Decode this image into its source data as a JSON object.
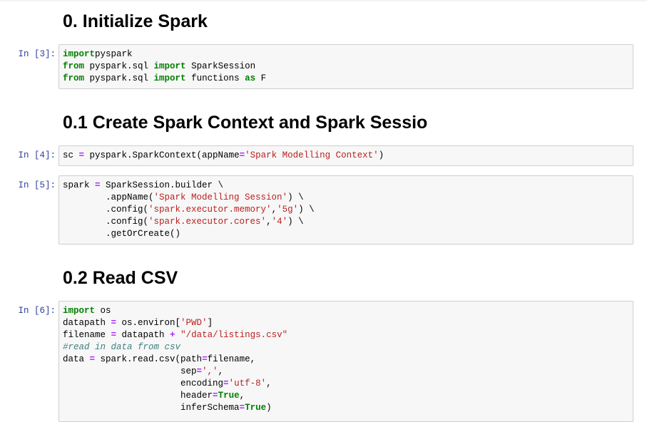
{
  "headings": {
    "h0": "0. Initialize Spark",
    "h1": "0.1 Create Spark Context and Spark Sessio",
    "h2": "0.2 Read CSV"
  },
  "prompts": {
    "p3": "In [3]:",
    "p4": "In [4]:",
    "p5": "In [5]:",
    "p6": "In [6]:"
  },
  "cells": {
    "c3": [
      [
        [
          "k",
          "import"
        ],
        [
          "",
          "pyspark"
        ]
      ],
      [
        [
          "k",
          "from"
        ],
        [
          "",
          " pyspark.sql "
        ],
        [
          "k",
          "import"
        ],
        [
          "",
          " SparkSession"
        ]
      ],
      [
        [
          "k",
          "from"
        ],
        [
          "",
          " pyspark.sql "
        ],
        [
          "k",
          "import"
        ],
        [
          "",
          " functions "
        ],
        [
          "k",
          "as"
        ],
        [
          "",
          " F"
        ]
      ]
    ],
    "c4": [
      [
        [
          "",
          "sc "
        ],
        [
          "o",
          "="
        ],
        [
          "",
          " pyspark.SparkContext(appName"
        ],
        [
          "o",
          "="
        ],
        [
          "s",
          "'Spark Modelling Context'"
        ],
        [
          "",
          ")"
        ]
      ]
    ],
    "c5": [
      [
        [
          "",
          "spark "
        ],
        [
          "o",
          "="
        ],
        [
          "",
          " SparkSession.builder \\"
        ]
      ],
      [
        [
          "",
          "        .appName("
        ],
        [
          "s",
          "'Spark Modelling Session'"
        ],
        [
          "",
          ") \\"
        ]
      ],
      [
        [
          "",
          "        .config("
        ],
        [
          "s",
          "'spark.executor.memory'"
        ],
        [
          "",
          ","
        ],
        [
          "s",
          "'5g'"
        ],
        [
          "",
          ") \\"
        ]
      ],
      [
        [
          "",
          "        .config("
        ],
        [
          "s",
          "'spark.executor.cores'"
        ],
        [
          "",
          ","
        ],
        [
          "s",
          "'4'"
        ],
        [
          "",
          ") \\"
        ]
      ],
      [
        [
          "",
          "        .getOrCreate()"
        ]
      ]
    ],
    "c6": [
      [
        [
          "k",
          "import"
        ],
        [
          "",
          " os"
        ]
      ],
      [
        [
          "",
          "datapath "
        ],
        [
          "o",
          "="
        ],
        [
          "",
          " os.environ["
        ],
        [
          "s",
          "'PWD'"
        ],
        [
          "",
          "]"
        ]
      ],
      [
        [
          "",
          "filename "
        ],
        [
          "o",
          "="
        ],
        [
          "",
          " datapath "
        ],
        [
          "o",
          "+"
        ],
        [
          "",
          " "
        ],
        [
          "s",
          "\"/data/listings.csv\""
        ]
      ],
      [
        [
          "c",
          "#read in data from csv"
        ]
      ],
      [
        [
          "",
          "data "
        ],
        [
          "o",
          "="
        ],
        [
          "",
          " spark.read.csv(path"
        ],
        [
          "o",
          "="
        ],
        [
          "",
          "filename,"
        ]
      ],
      [
        [
          "",
          "                      sep"
        ],
        [
          "o",
          "="
        ],
        [
          "s",
          "','"
        ],
        [
          "",
          ","
        ]
      ],
      [
        [
          "",
          "                      encoding"
        ],
        [
          "o",
          "="
        ],
        [
          "s",
          "'utf-8'"
        ],
        [
          "",
          ","
        ]
      ],
      [
        [
          "",
          "                      header"
        ],
        [
          "o",
          "="
        ],
        [
          "k",
          "True"
        ],
        [
          "",
          ","
        ]
      ],
      [
        [
          "",
          "                      inferSchema"
        ],
        [
          "o",
          "="
        ],
        [
          "k",
          "True"
        ],
        [
          "",
          ")"
        ]
      ]
    ]
  }
}
